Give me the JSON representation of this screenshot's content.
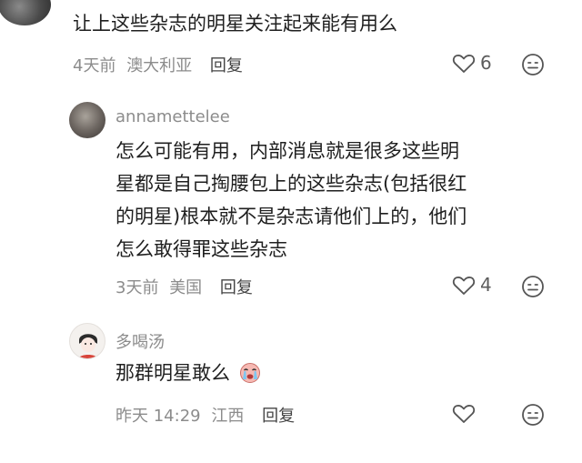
{
  "comments": [
    {
      "text": "让上这些杂志的明星关注起来能有用么",
      "time": "4天前",
      "location": "澳大利亚",
      "reply_label": "回复",
      "likes": "6"
    },
    {
      "username": "annamettelee",
      "text_lines": [
        "怎么可能有用，内部消息就是很多这些明",
        "星都是自己掏腰包上的这些杂志(包括很红",
        "的明星)根本就不是杂志请他们上的，他们",
        "怎么敢得罪这些杂志"
      ],
      "time": "3天前",
      "location": "美国",
      "reply_label": "回复",
      "likes": "4"
    },
    {
      "username": "多喝汤",
      "text": "那群明星敢么",
      "emoji": "crying-face-emoji",
      "time": "昨天 14:29",
      "location": "江西",
      "reply_label": "回复",
      "likes": ""
    }
  ],
  "icons": {
    "like": "heart-outline-icon",
    "react": "emoji-face-icon"
  },
  "colors": {
    "meta": "#8c8c8c",
    "text": "#1f1f1f",
    "icon": "#555555"
  }
}
